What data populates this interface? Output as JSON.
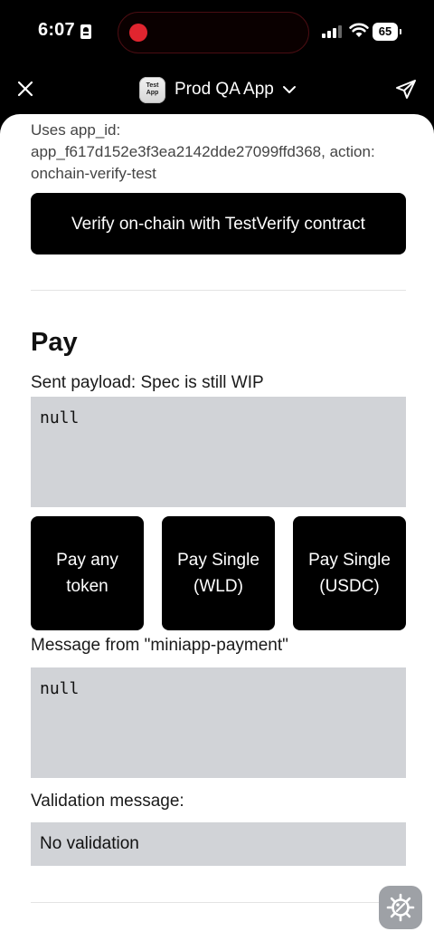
{
  "status_bar": {
    "time": "6:07",
    "battery": "65",
    "icons": [
      "id-card-icon",
      "signal-icon",
      "wifi-icon",
      "battery-icon"
    ]
  },
  "header": {
    "close_icon": "close-icon",
    "logo_text": "Test App",
    "title": "Prod QA App",
    "dropdown_icon": "chevron-down-icon",
    "share_icon": "send-icon"
  },
  "verify": {
    "info": "Uses app_id: app_f617d152e3f3ea2142dde27099ffd368, action: onchain-verify-test",
    "button_label": "Verify on-chain with TestVerify contract"
  },
  "pay": {
    "title": "Pay",
    "sent_payload_label": "Sent payload: Spec is still WIP",
    "sent_payload_value": "null",
    "buttons": [
      {
        "label": "Pay any token"
      },
      {
        "label": "Pay Single (WLD)"
      },
      {
        "label": "Pay Single (USDC)"
      }
    ],
    "message_label": "Message from \"miniapp-payment\"",
    "message_value": "null",
    "validation_label": "Validation message:",
    "validation_value": "No validation"
  },
  "fab": {
    "icon": "settings-gear-icon"
  },
  "colors": {
    "background": "#000000",
    "card": "#ffffff",
    "button": "#000000",
    "code_box": "#d1d3d7",
    "record_dot": "#e0252f",
    "fab": "#9ea1a6"
  }
}
